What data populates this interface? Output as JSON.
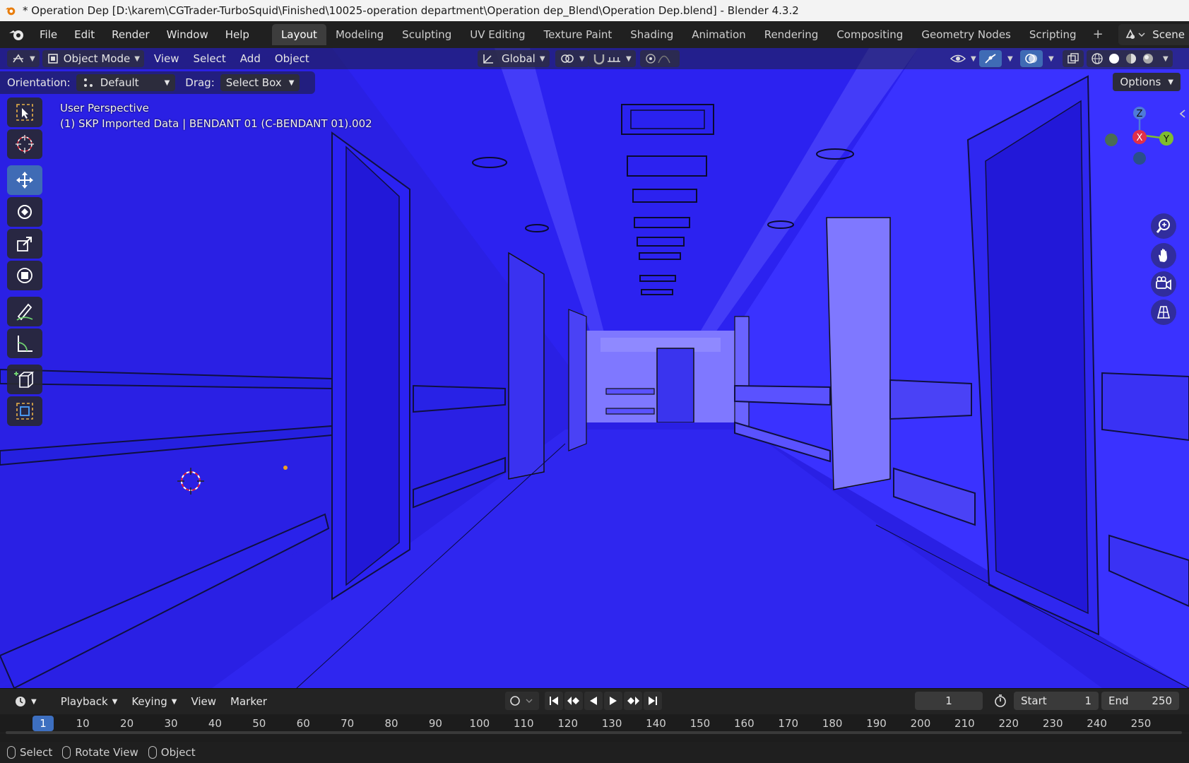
{
  "window": {
    "title": "* Operation Dep [D:\\karem\\CGTrader-TurboSquid\\Finished\\10025-operation department\\Operation dep_Blend\\Operation Dep.blend] - Blender 4.3.2"
  },
  "menu": {
    "items": [
      "File",
      "Edit",
      "Render",
      "Window",
      "Help"
    ]
  },
  "workspaces": {
    "tabs": [
      "Layout",
      "Modeling",
      "Sculpting",
      "UV Editing",
      "Texture Paint",
      "Shading",
      "Animation",
      "Rendering",
      "Compositing",
      "Geometry Nodes",
      "Scripting"
    ],
    "active": "Layout",
    "add": "+"
  },
  "scene": {
    "label": "Scene"
  },
  "viewport_header": {
    "mode": "Object Mode",
    "menus": [
      "View",
      "Select",
      "Add",
      "Object"
    ],
    "transform_orientation": "Global"
  },
  "tool_settings": {
    "orientation_label": "Orientation:",
    "orientation_value": "Default",
    "drag_label": "Drag:",
    "drag_value": "Select Box",
    "options": "Options"
  },
  "viewport_info": {
    "line1": "User Perspective",
    "line2": "(1) SKP Imported Data | BENDANT 01 (C-BENDANT 01).002"
  },
  "gizmo": {
    "z": "Z",
    "x": "X",
    "y": "Y"
  },
  "timeline": {
    "menus": [
      "Playback",
      "Keying",
      "View",
      "Marker"
    ],
    "current_frame": "1",
    "start_label": "Start",
    "start": "1",
    "end_label": "End",
    "end": "250",
    "ticks": [
      "1",
      "10",
      "20",
      "30",
      "40",
      "50",
      "60",
      "70",
      "80",
      "90",
      "100",
      "110",
      "120",
      "130",
      "140",
      "150",
      "160",
      "170",
      "180",
      "190",
      "200",
      "210",
      "220",
      "230",
      "240",
      "250"
    ]
  },
  "status": {
    "items": [
      "Select",
      "Rotate View",
      "Object"
    ]
  },
  "colors": {
    "viewport_blue": "#2a21e6",
    "active_blue": "#3f6bb5"
  }
}
